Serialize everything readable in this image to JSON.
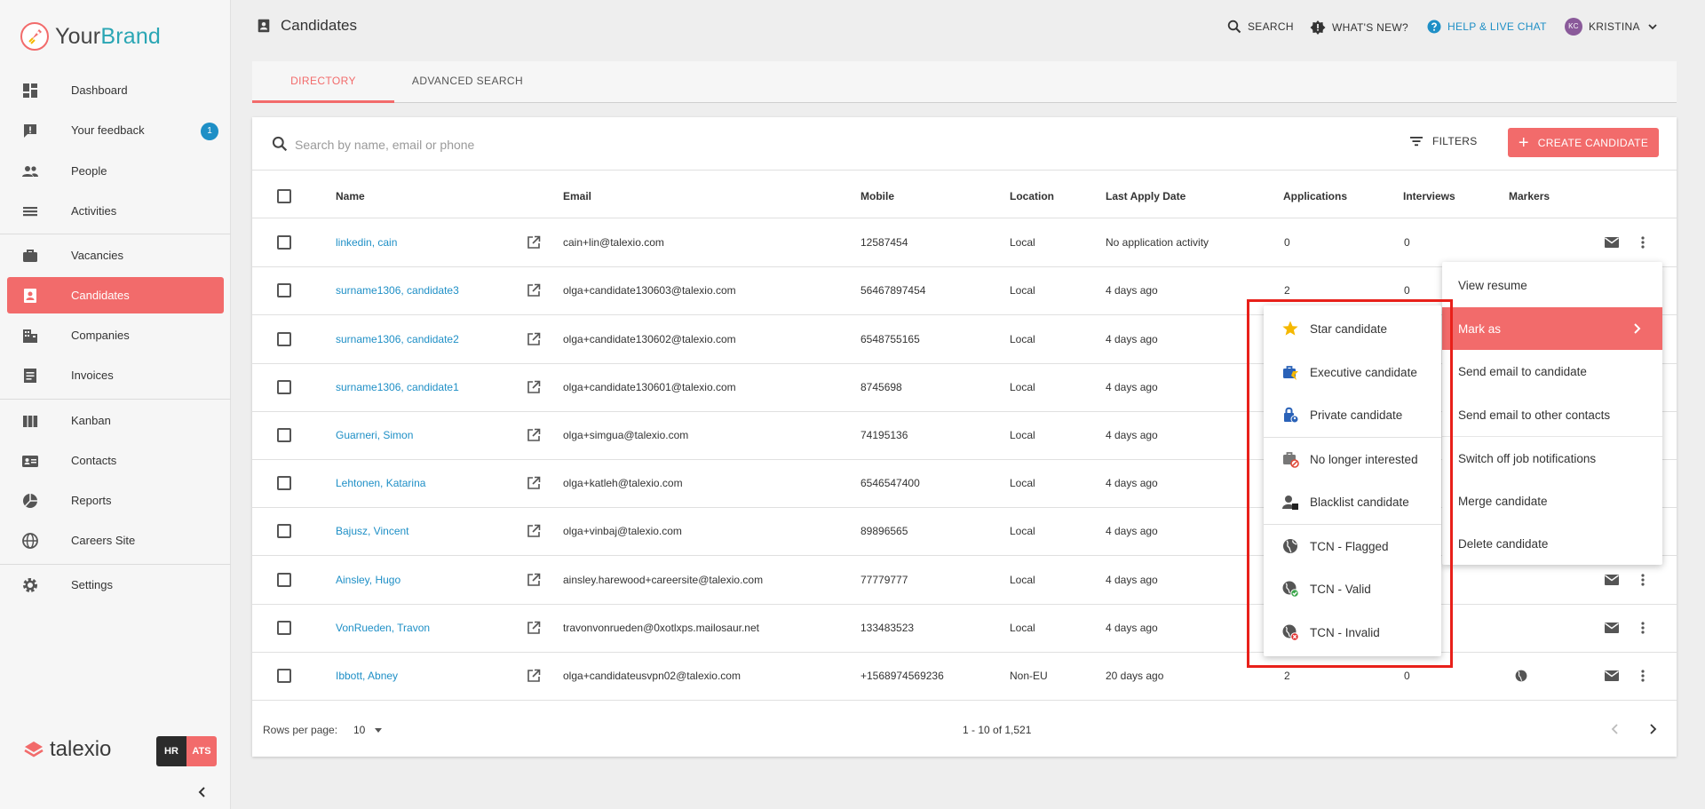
{
  "brand": {
    "name_part1": "Your",
    "name_part2": "Brand"
  },
  "sidebar": {
    "items": [
      {
        "label": "Dashboard",
        "icon": "dashboard-icon"
      },
      {
        "label": "Your feedback",
        "icon": "feedback-icon",
        "badge": "1"
      },
      {
        "label": "People",
        "icon": "people-icon"
      },
      {
        "label": "Activities",
        "icon": "activities-icon"
      },
      {
        "label": "Vacancies",
        "icon": "briefcase-icon"
      },
      {
        "label": "Candidates",
        "icon": "candidate-badge-icon",
        "active": true
      },
      {
        "label": "Companies",
        "icon": "building-icon"
      },
      {
        "label": "Invoices",
        "icon": "invoice-icon"
      },
      {
        "label": "Kanban",
        "icon": "kanban-icon"
      },
      {
        "label": "Contacts",
        "icon": "contact-card-icon"
      },
      {
        "label": "Reports",
        "icon": "pie-chart-icon"
      },
      {
        "label": "Careers Site",
        "icon": "globe-icon"
      },
      {
        "label": "Settings",
        "icon": "gear-icon"
      }
    ],
    "footer_logo": "talexio",
    "toggle": {
      "hr": "HR",
      "ats": "ATS"
    }
  },
  "header": {
    "title": "Candidates",
    "search": "SEARCH",
    "whats_new": "WHAT'S NEW?",
    "help": "HELP & LIVE CHAT",
    "user_initials": "KC",
    "user_name": "KRISTINA"
  },
  "tabs": [
    {
      "label": "DIRECTORY",
      "active": true
    },
    {
      "label": "ADVANCED SEARCH"
    }
  ],
  "toolbar": {
    "search_placeholder": "Search by name, email or phone",
    "filters": "FILTERS",
    "create": "CREATE CANDIDATE"
  },
  "table": {
    "headers": [
      "Name",
      "Email",
      "Mobile",
      "Location",
      "Last Apply Date",
      "Applications",
      "Interviews",
      "Markers"
    ],
    "rows": [
      {
        "name": "linkedin, cain",
        "email": "cain+lin@talexio.com",
        "mobile": "12587454",
        "location": "Local",
        "last_apply": "No application activity",
        "applications": "0",
        "interviews": "0",
        "marker": ""
      },
      {
        "name": "surname1306, candidate3",
        "email": "olga+candidate130603@talexio.com",
        "mobile": "56467897454",
        "location": "Local",
        "last_apply": "4 days ago",
        "applications": "2",
        "interviews": "0",
        "marker": ""
      },
      {
        "name": "surname1306, candidate2",
        "email": "olga+candidate130602@talexio.com",
        "mobile": "6548755165",
        "location": "Local",
        "last_apply": "4 days ago",
        "applications": "",
        "interviews": "",
        "marker": ""
      },
      {
        "name": "surname1306, candidate1",
        "email": "olga+candidate130601@talexio.com",
        "mobile": "8745698",
        "location": "Local",
        "last_apply": "4 days ago",
        "applications": "",
        "interviews": "",
        "marker": ""
      },
      {
        "name": "Guarneri, Simon",
        "email": "olga+simgua@talexio.com",
        "mobile": "74195136",
        "location": "Local",
        "last_apply": "4 days ago",
        "applications": "",
        "interviews": "",
        "marker": ""
      },
      {
        "name": "Lehtonen, Katarina",
        "email": "olga+katleh@talexio.com",
        "mobile": "6546547400",
        "location": "Local",
        "last_apply": "4 days ago",
        "applications": "",
        "interviews": "",
        "marker": ""
      },
      {
        "name": "Bajusz, Vincent",
        "email": "olga+vinbaj@talexio.com",
        "mobile": "89896565",
        "location": "Local",
        "last_apply": "4 days ago",
        "applications": "",
        "interviews": "",
        "marker": ""
      },
      {
        "name": "Ainsley, Hugo",
        "email": "ainsley.harewood+careersite@talexio.com",
        "mobile": "77779777",
        "location": "Local",
        "last_apply": "4 days ago",
        "applications": "",
        "interviews": "",
        "marker": ""
      },
      {
        "name": "VonRueden, Travon",
        "email": "travonvonrueden@0xotlxps.mailosaur.net",
        "mobile": "133483523",
        "location": "Local",
        "last_apply": "4 days ago",
        "applications": "",
        "interviews": "",
        "marker": ""
      },
      {
        "name": "Ibbott, Abney",
        "email": "olga+candidateusvpn02@talexio.com",
        "mobile": "+1568974569236",
        "location": "Non-EU",
        "last_apply": "20 days ago",
        "applications": "2",
        "interviews": "0",
        "marker": "globe-icon"
      }
    ]
  },
  "pagination": {
    "rows_label": "Rows per page:",
    "rows_value": "10",
    "range": "1 - 10 of 1,521"
  },
  "context_menu": [
    "View resume",
    "Mark as",
    "Send email to candidate",
    "Send email to other contacts",
    "Switch off job notifications",
    "Merge candidate",
    "Delete candidate"
  ],
  "mark_as_menu": [
    {
      "label": "Star candidate",
      "icon": "star-icon",
      "color": "#f5b800"
    },
    {
      "label": "Executive candidate",
      "icon": "executive-briefcase-icon",
      "color": "#2a62b8"
    },
    {
      "label": "Private candidate",
      "icon": "lock-person-icon",
      "color": "#2a62b8"
    },
    {
      "label": "No longer interested",
      "icon": "briefcase-cancel-icon",
      "color": "#e04a3a"
    },
    {
      "label": "Blacklist candidate",
      "icon": "person-block-icon",
      "color": "#555555"
    },
    {
      "label": "TCN - Flagged",
      "icon": "globe-icon",
      "color": "#555555"
    },
    {
      "label": "TCN - Valid",
      "icon": "globe-check-icon",
      "color": "#3aa64a"
    },
    {
      "label": "TCN - Invalid",
      "icon": "globe-cancel-icon",
      "color": "#e02a2a"
    }
  ],
  "colors": {
    "accent": "#f26b6b",
    "link": "#1e8fc6",
    "highlight": "#e8201a"
  }
}
